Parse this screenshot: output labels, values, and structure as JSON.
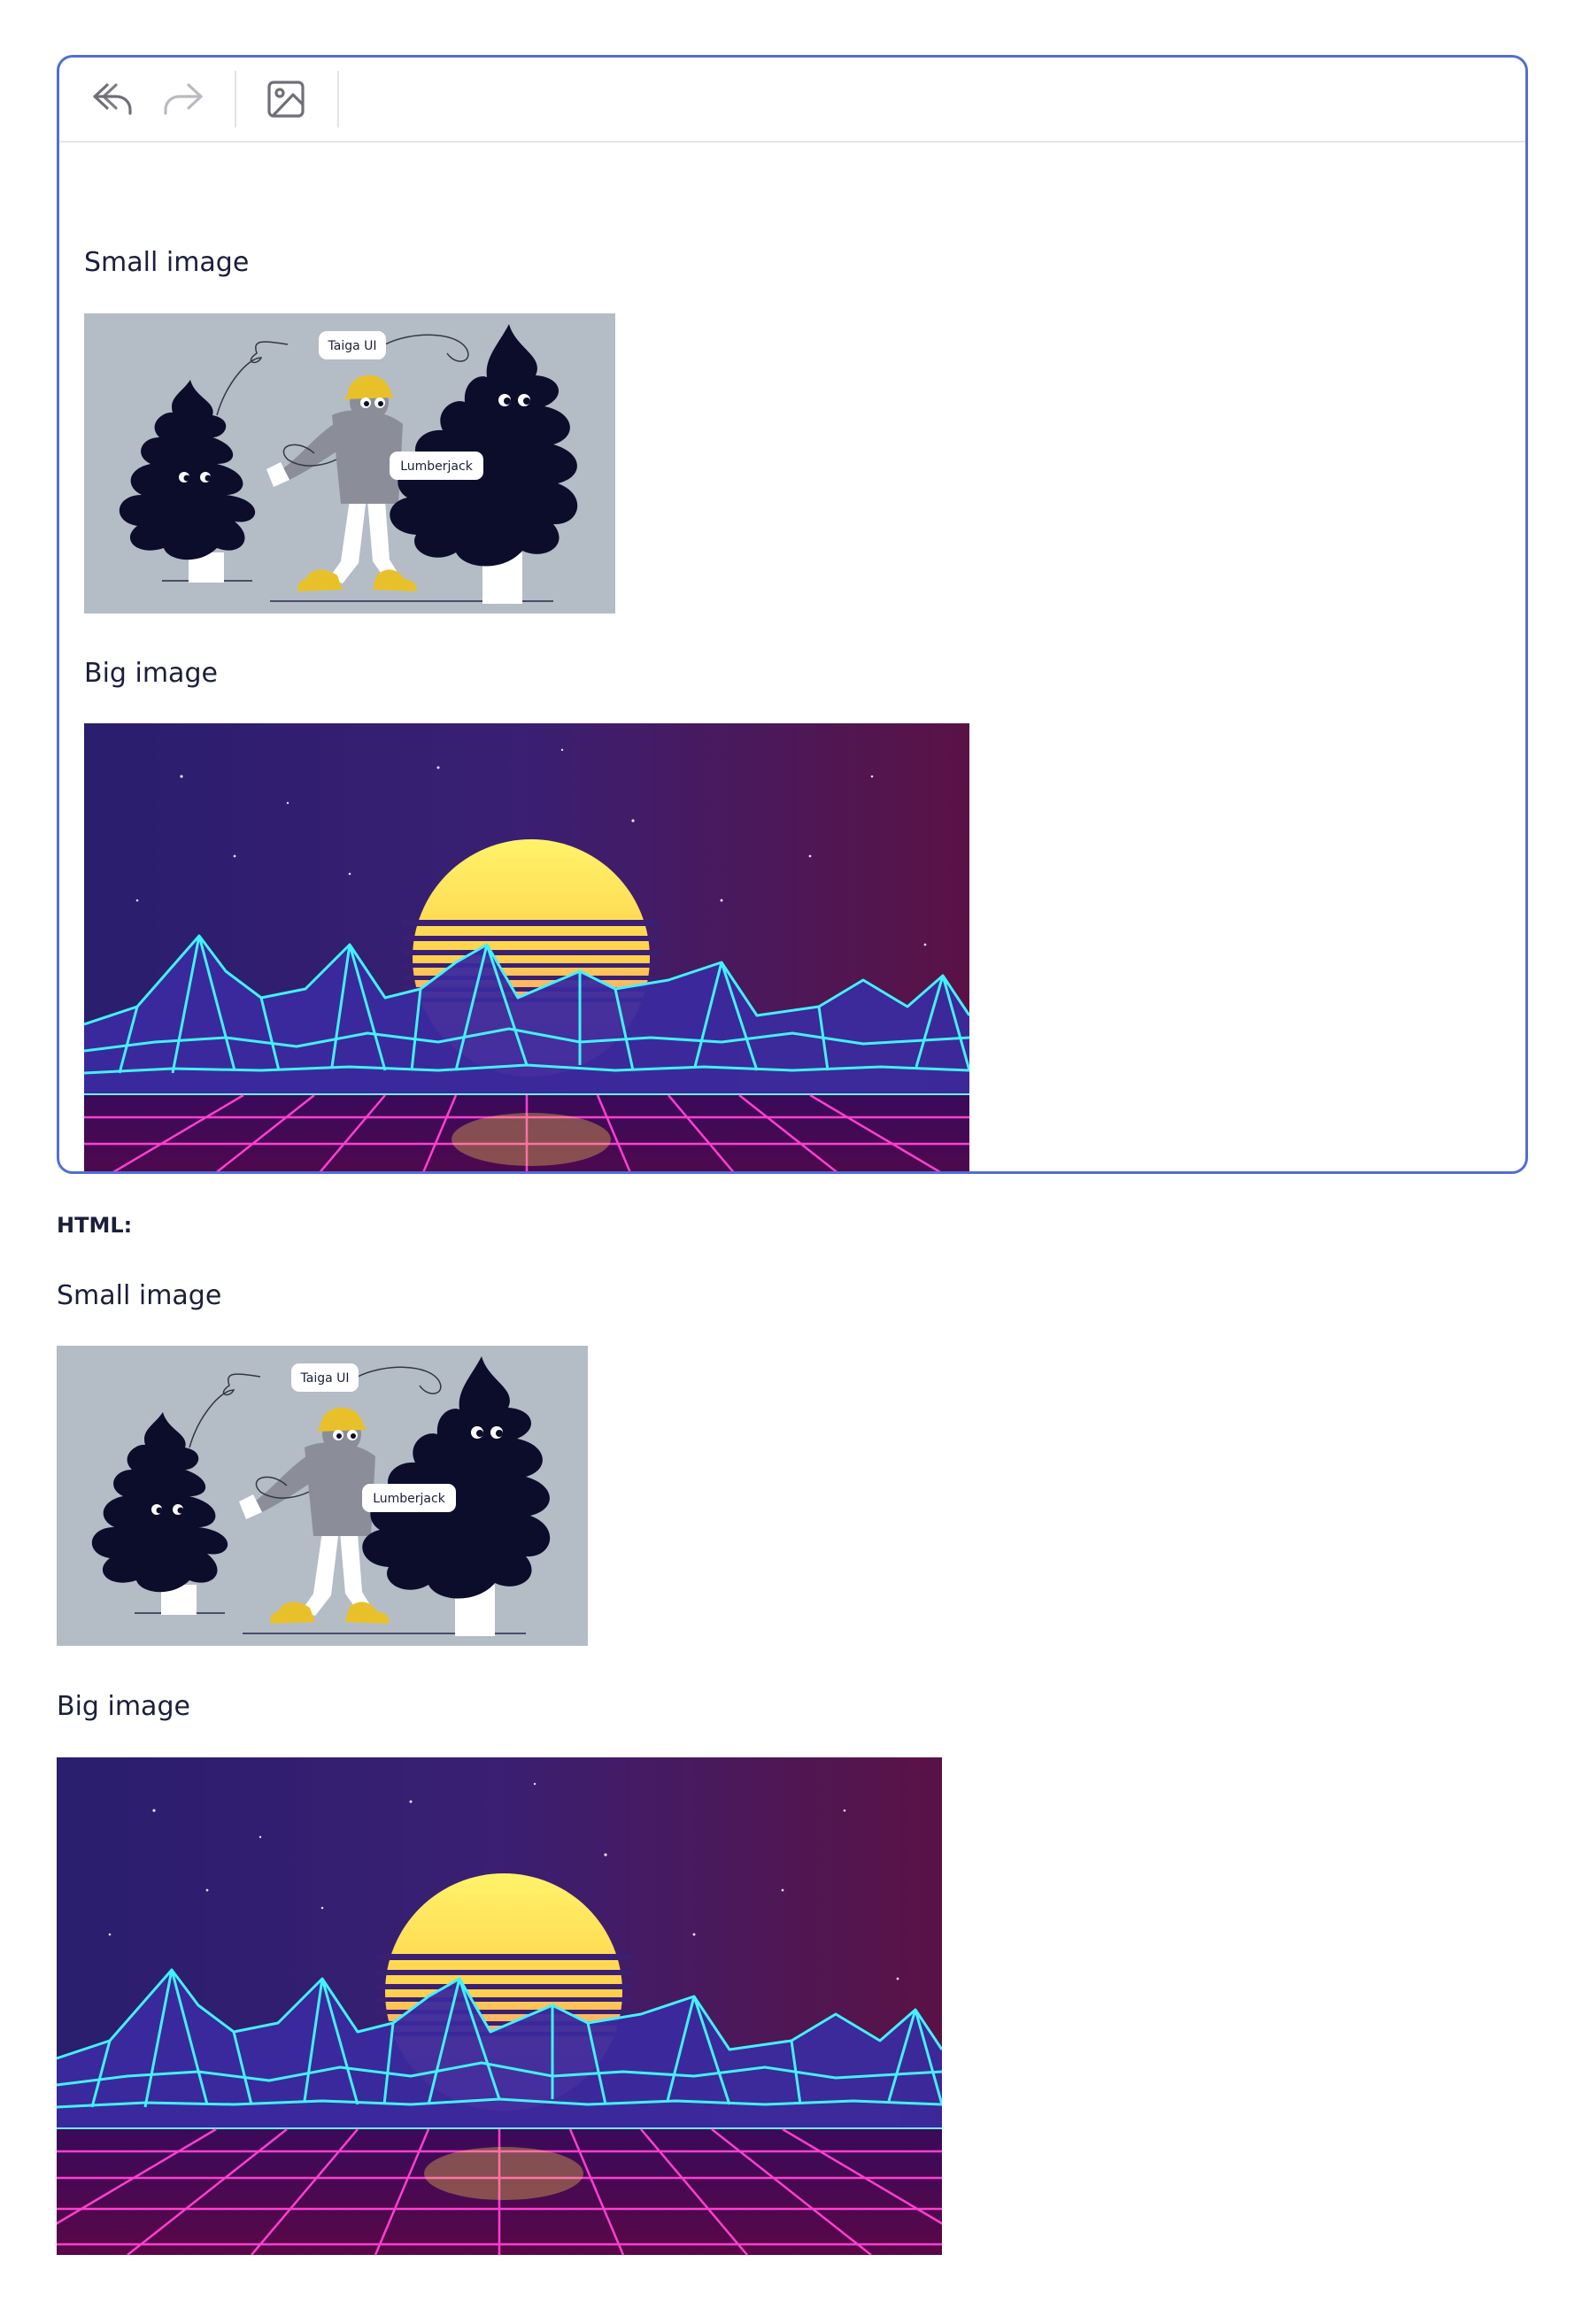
{
  "toolbar": {
    "undo": "undo-icon",
    "redo": "redo-icon",
    "image": "image-icon"
  },
  "editor": {
    "small_label": "Small image",
    "big_label": "Big image",
    "small_image_labels": [
      "Taiga UI",
      "Lumberjack"
    ]
  },
  "output": {
    "heading": "HTML:",
    "small_label": "Small image",
    "big_label": "Big image",
    "small_image_labels": [
      "Taiga UI",
      "Lumberjack"
    ]
  },
  "colors": {
    "border": "#526ed3",
    "text": "#1b1f3b",
    "small_bg": "#b4bcc6",
    "tree": "#0b0d2b",
    "accent_yellow": "#e8c12a"
  }
}
